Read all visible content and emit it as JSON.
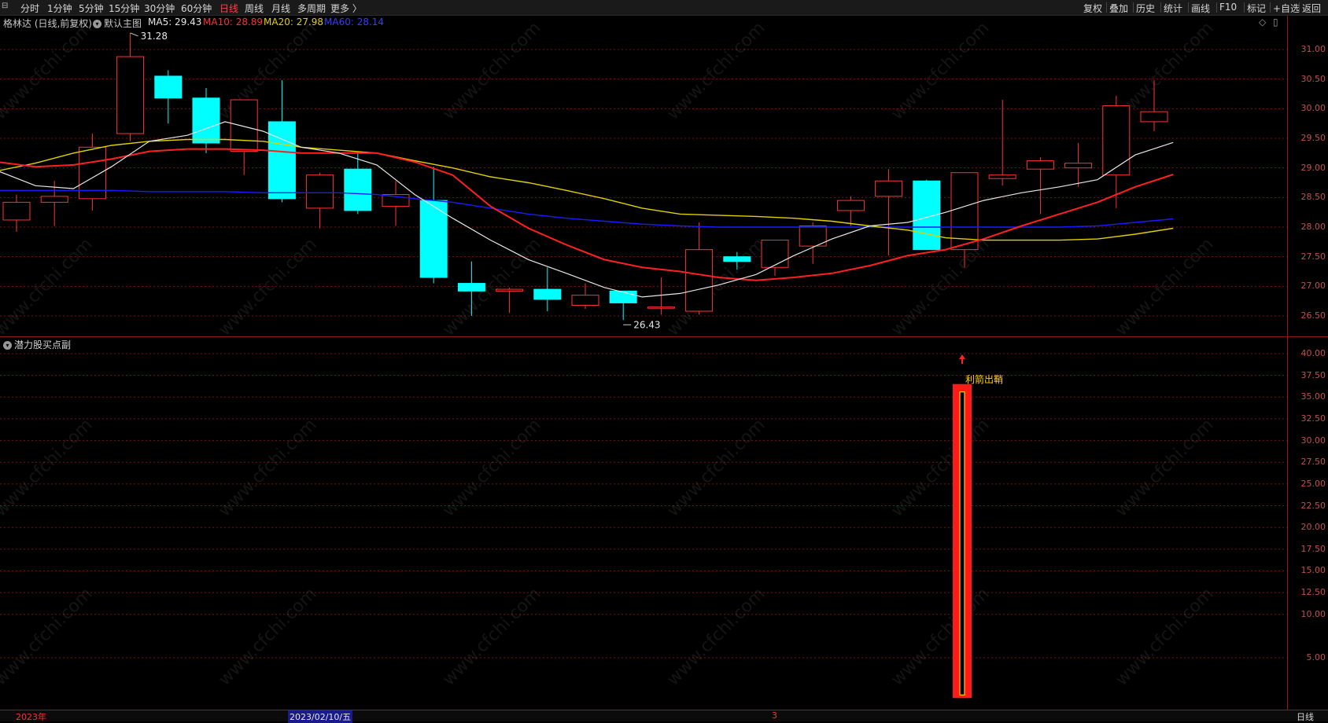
{
  "toolbar": {
    "periods": [
      "分时",
      "1分钟",
      "5分钟",
      "15分钟",
      "30分钟",
      "60分钟",
      "日线",
      "周线",
      "月线",
      "多周期",
      "更多 〉"
    ],
    "active_period": "日线",
    "right_buttons": [
      "复权",
      "叠加",
      "历史",
      "统计",
      "画线",
      "F10",
      "标记",
      "+自选",
      "返回"
    ]
  },
  "header": {
    "stock_title": "格林达 (日线,前复权)",
    "main_template": "默认主图",
    "ma5": "MA5: 29.43",
    "ma10": "MA10: 28.89",
    "ma20": "MA20: 27.98",
    "ma60": "MA60: 28.14"
  },
  "colors": {
    "up": "#ff3232",
    "down": "#00ffff",
    "ma5": "#e6e6e6",
    "ma10": "#ff2020",
    "ma20": "#e0d000",
    "ma60": "#1a1aff",
    "grid": "#7a1010"
  },
  "main_yaxis": [
    "31.00",
    "30.50",
    "30.00",
    "29.50",
    "29.00",
    "28.50",
    "28.00",
    "27.50",
    "27.00",
    "26.50"
  ],
  "sub_panel": {
    "title": "潜力股买点副",
    "signal_label": "利箭出鞘",
    "yaxis": [
      "40.00",
      "37.50",
      "35.00",
      "32.50",
      "30.00",
      "27.50",
      "25.00",
      "22.50",
      "20.00",
      "17.50",
      "15.00",
      "12.50",
      "10.00",
      "5.00"
    ]
  },
  "annotations": {
    "high": "31.28",
    "low": "26.43"
  },
  "bottom_axis": {
    "year": "2023年",
    "date": "2023/02/10/五",
    "month_mark": "3",
    "period_label": "日线"
  },
  "watermark": "www.cfchi.com",
  "chart_data": {
    "type": "candlestick",
    "candles": [
      {
        "o": 28.12,
        "h": 28.55,
        "l": 27.92,
        "c": 28.42
      },
      {
        "o": 28.42,
        "h": 28.78,
        "l": 28.02,
        "c": 28.52
      },
      {
        "o": 28.48,
        "h": 29.58,
        "l": 28.28,
        "c": 29.35
      },
      {
        "o": 29.58,
        "h": 31.28,
        "l": 29.45,
        "c": 30.88
      },
      {
        "o": 30.55,
        "h": 30.65,
        "l": 29.75,
        "c": 30.18
      },
      {
        "o": 30.18,
        "h": 30.35,
        "l": 29.25,
        "c": 29.42
      },
      {
        "o": 29.28,
        "h": 30.15,
        "l": 28.88,
        "c": 30.15
      },
      {
        "o": 29.78,
        "h": 30.48,
        "l": 28.42,
        "c": 28.48
      },
      {
        "o": 28.32,
        "h": 28.92,
        "l": 27.98,
        "c": 28.88
      },
      {
        "o": 28.98,
        "h": 29.28,
        "l": 28.22,
        "c": 28.28
      },
      {
        "o": 28.35,
        "h": 28.78,
        "l": 28.02,
        "c": 28.55
      },
      {
        "o": 28.45,
        "h": 29.02,
        "l": 27.05,
        "c": 27.15
      },
      {
        "o": 27.05,
        "h": 27.42,
        "l": 26.5,
        "c": 26.92
      },
      {
        "o": 26.92,
        "h": 26.98,
        "l": 26.55,
        "c": 26.95
      },
      {
        "o": 26.95,
        "h": 27.32,
        "l": 26.58,
        "c": 26.78
      },
      {
        "o": 26.68,
        "h": 27.05,
        "l": 26.62,
        "c": 26.85
      },
      {
        "o": 26.92,
        "h": 26.92,
        "l": 26.43,
        "c": 26.72
      },
      {
        "o": 26.65,
        "h": 27.15,
        "l": 26.52,
        "c": 26.65
      },
      {
        "o": 26.58,
        "h": 28.08,
        "l": 26.52,
        "c": 27.62
      },
      {
        "o": 27.5,
        "h": 27.58,
        "l": 27.28,
        "c": 27.42
      },
      {
        "o": 27.32,
        "h": 27.78,
        "l": 27.18,
        "c": 27.78
      },
      {
        "o": 27.68,
        "h": 28.08,
        "l": 27.38,
        "c": 28.02
      },
      {
        "o": 28.28,
        "h": 28.52,
        "l": 28.02,
        "c": 28.45
      },
      {
        "o": 28.52,
        "h": 28.98,
        "l": 27.52,
        "c": 28.78
      },
      {
        "o": 28.78,
        "h": 28.8,
        "l": 27.62,
        "c": 27.62
      },
      {
        "o": 27.62,
        "h": 28.92,
        "l": 27.32,
        "c": 28.92
      },
      {
        "o": 28.82,
        "h": 30.15,
        "l": 28.7,
        "c": 28.88
      },
      {
        "o": 28.98,
        "h": 29.18,
        "l": 28.22,
        "c": 29.12
      },
      {
        "o": 29.0,
        "h": 29.42,
        "l": 28.68,
        "c": 29.08
      },
      {
        "o": 28.88,
        "h": 30.22,
        "l": 28.32,
        "c": 30.05
      },
      {
        "o": 29.78,
        "h": 30.48,
        "l": 29.62,
        "c": 29.95
      }
    ],
    "ma5": [
      28.95,
      28.7,
      28.65,
      29.02,
      29.45,
      29.55,
      29.78,
      29.62,
      29.35,
      29.25,
      29.05,
      28.55,
      28.15,
      27.78,
      27.45,
      27.22,
      26.98,
      26.82,
      26.88,
      27.02,
      27.2,
      27.52,
      27.8,
      28.02,
      28.08,
      28.25,
      28.45,
      28.58,
      28.68,
      28.8,
      29.22,
      29.43
    ],
    "ma10": [
      29.1,
      29.02,
      29.05,
      29.15,
      29.28,
      29.32,
      29.32,
      29.3,
      29.25,
      29.25,
      29.25,
      29.1,
      28.88,
      28.35,
      27.98,
      27.7,
      27.45,
      27.32,
      27.25,
      27.15,
      27.1,
      27.15,
      27.22,
      27.35,
      27.52,
      27.62,
      27.8,
      28.02,
      28.22,
      28.42,
      28.68,
      28.89
    ],
    "ma20": [
      28.95,
      29.08,
      29.25,
      29.38,
      29.45,
      29.48,
      29.48,
      29.45,
      29.35,
      29.3,
      29.25,
      29.12,
      29.0,
      28.85,
      28.75,
      28.62,
      28.48,
      28.32,
      28.22,
      28.2,
      28.18,
      28.15,
      28.1,
      28.02,
      27.95,
      27.82,
      27.78,
      27.78,
      27.78,
      27.8,
      27.88,
      27.98
    ],
    "ma60": [
      28.62,
      28.62,
      28.62,
      28.62,
      28.6,
      28.6,
      28.6,
      28.58,
      28.58,
      28.58,
      28.55,
      28.48,
      28.42,
      28.32,
      28.22,
      28.15,
      28.1,
      28.05,
      28.02,
      28.0,
      28.0,
      28.0,
      28.0,
      28.0,
      28.0,
      28.0,
      28.0,
      28.0,
      28.0,
      28.02,
      28.08,
      28.14
    ],
    "signal": {
      "index": 25,
      "value": 36.5
    },
    "main_ylim": [
      26.3,
      31.45
    ],
    "sub_ylim": [
      0,
      42
    ]
  }
}
